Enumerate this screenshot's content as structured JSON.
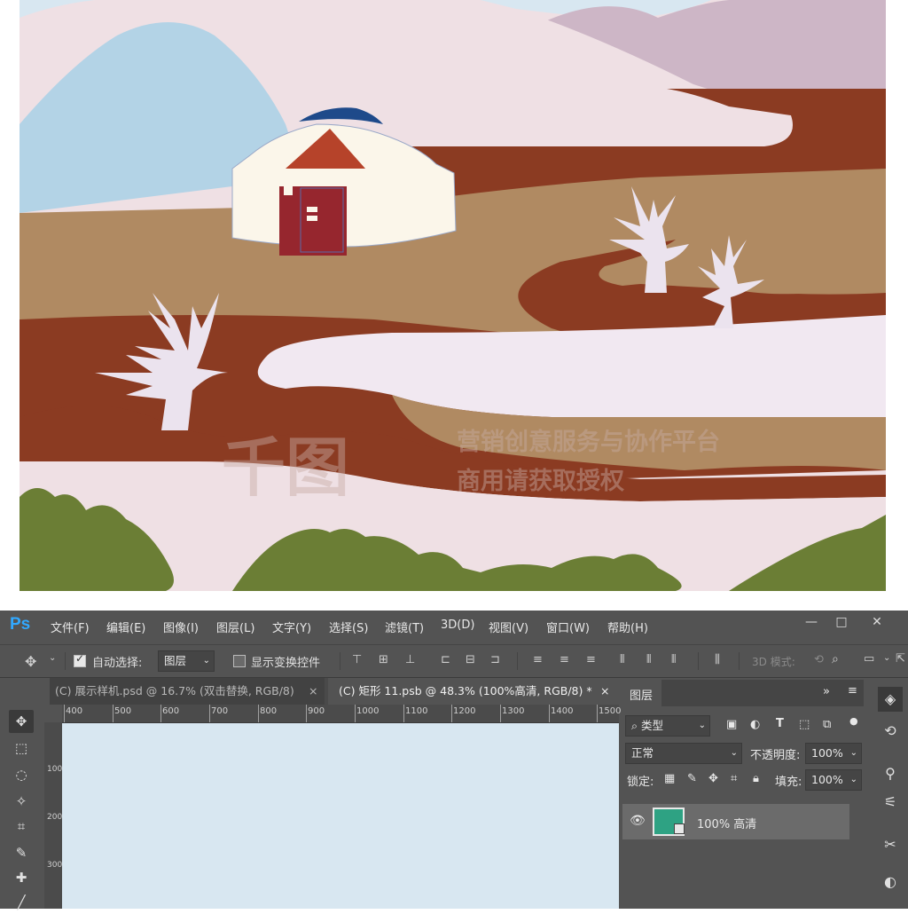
{
  "watermark": {
    "logo_text": "千图",
    "line1": "营销创意服务与协作平台",
    "line2": "商用请获取授权"
  },
  "app": {
    "logo": "Ps",
    "menu": [
      "文件(F)",
      "编辑(E)",
      "图像(I)",
      "图层(L)",
      "文字(Y)",
      "选择(S)",
      "滤镜(T)",
      "3D(D)",
      "视图(V)",
      "窗口(W)",
      "帮助(H)"
    ],
    "window_buttons": {
      "minimize": "—",
      "restore": "□",
      "close": "✕"
    }
  },
  "options_bar": {
    "auto_select_label": "自动选择:",
    "auto_select_value": "图层",
    "show_transform_label": "显示变换控件",
    "mode_3d_label": "3D 模式:"
  },
  "tabs": [
    {
      "title": "(C) 展示样机.psd @ 16.7% (双击替换, RGB/8)",
      "close": "×",
      "active": false
    },
    {
      "title": "(C) 矩形 11.psb @ 48.3% (100%高清, RGB/8) *",
      "close": "×",
      "active": true
    }
  ],
  "ruler": {
    "h_labels": [
      "400",
      "500",
      "600",
      "700",
      "800",
      "900",
      "1000",
      "1100",
      "1200",
      "1300",
      "1400",
      "1500"
    ],
    "v_labels": [
      "100",
      "200",
      "300"
    ]
  },
  "layers_panel": {
    "title": "图层",
    "filter_label": "类型",
    "blend_mode": "正常",
    "opacity_label": "不透明度:",
    "opacity_value": "100%",
    "lock_label": "锁定:",
    "fill_label": "填充:",
    "fill_value": "100%",
    "layers": [
      {
        "name": "100% 高清",
        "visible": true,
        "thumb_color": "#2ea283"
      }
    ]
  },
  "colors": {
    "canvas": "#d8e7f1",
    "ps_bg": "#535353",
    "ps_dark": "#454545",
    "accent_logo": "#31a8ff"
  }
}
